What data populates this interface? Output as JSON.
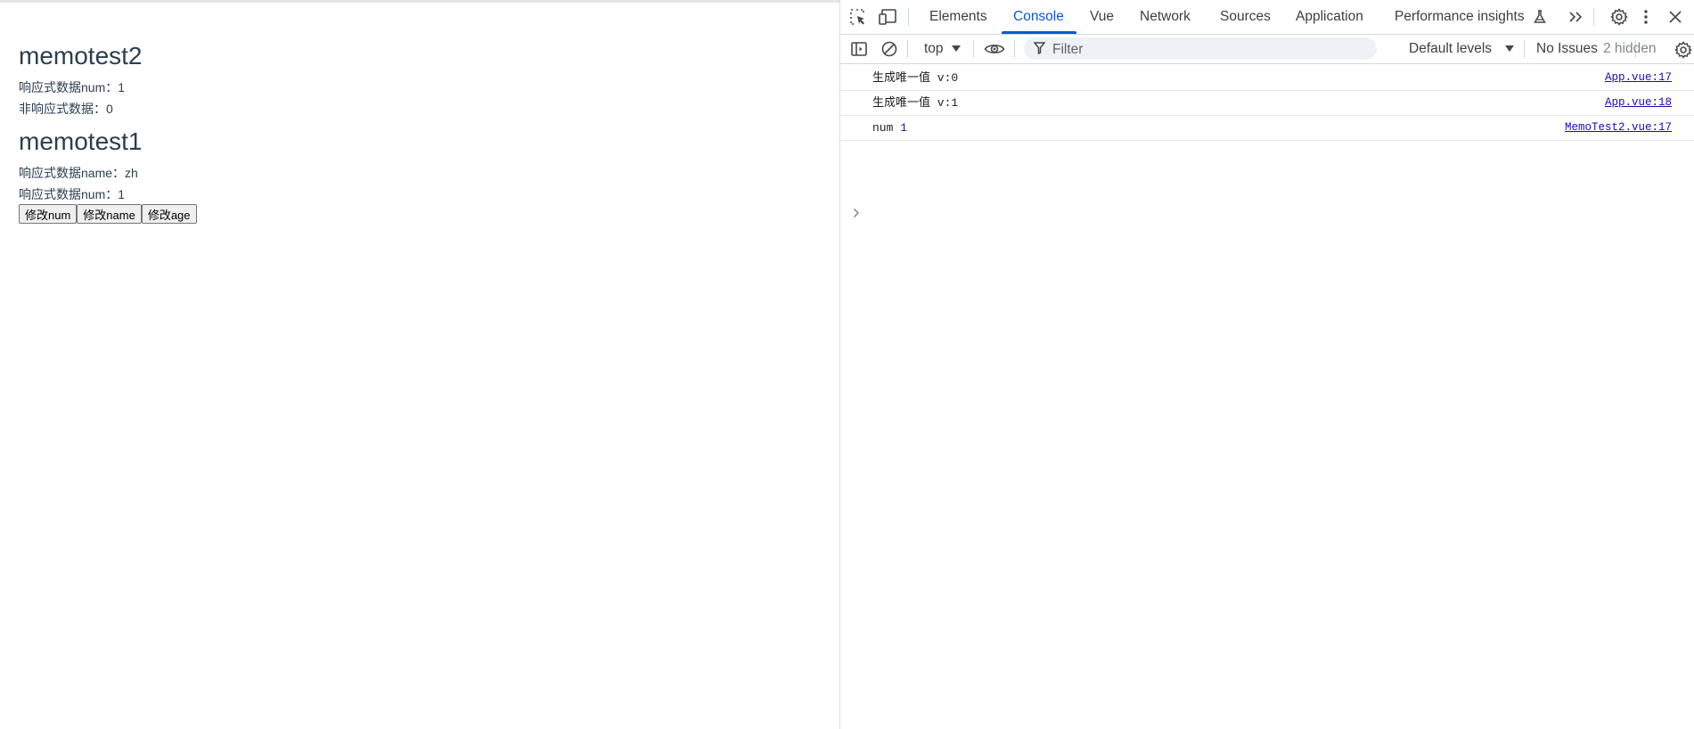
{
  "page": {
    "heading1": "memotest2",
    "line1": "响应式数据num：1",
    "line2": "非响应式数据：0",
    "heading2": "memotest1",
    "line3": "响应式数据name：zh",
    "line4": "响应式数据num：1",
    "buttons": [
      "修改num",
      "修改name",
      "修改age"
    ]
  },
  "devtools": {
    "tabs": [
      "Elements",
      "Console",
      "Vue",
      "Network",
      "Sources",
      "Application",
      "Performance insights"
    ],
    "active_tab": "Console",
    "toolbar": {
      "context": "top",
      "filter_placeholder": "Filter",
      "levels": "Default levels",
      "issues": "No Issues",
      "hidden": "2 hidden"
    },
    "logs": [
      {
        "text": "生成唯一值 v:0",
        "source": "App.vue:17"
      },
      {
        "text": "生成唯一值 v:1",
        "source": "App.vue:18"
      },
      {
        "label": "num",
        "value": "1",
        "source": "MemoTest2.vue:17"
      }
    ],
    "accent_color": "#0b57d0"
  }
}
